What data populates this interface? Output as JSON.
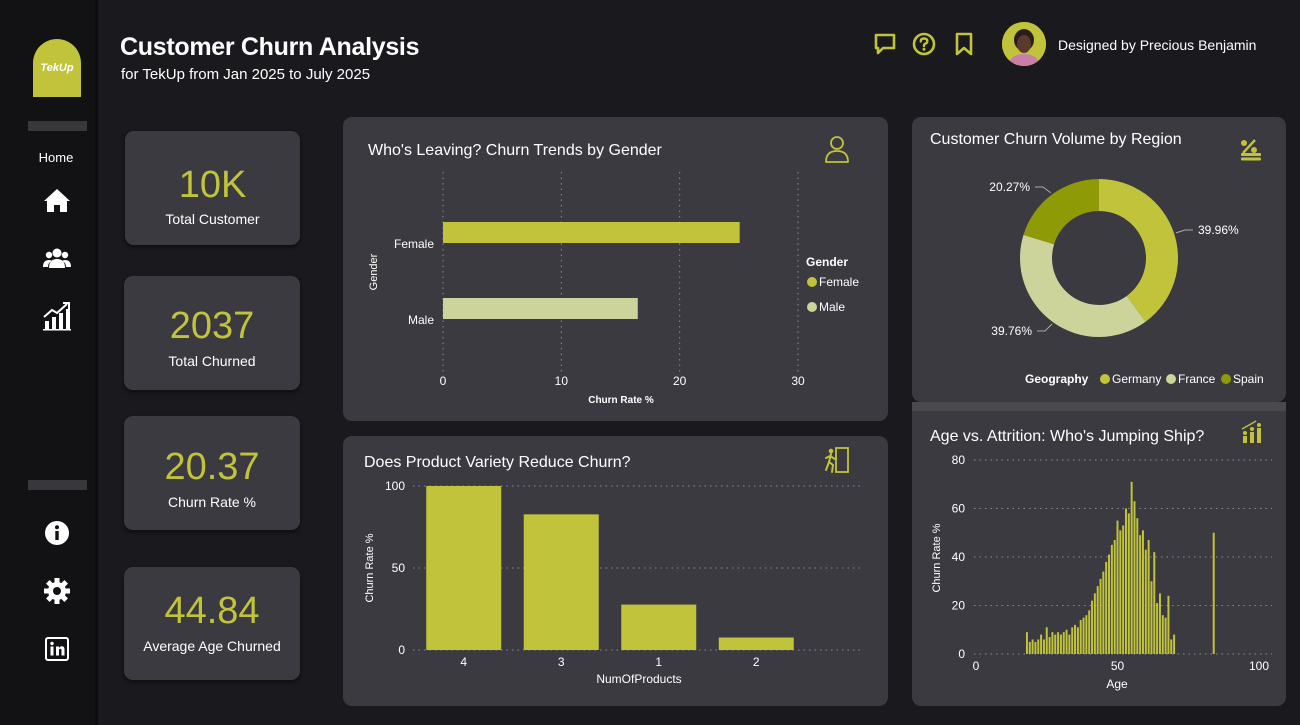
{
  "header": {
    "title": "Customer Churn Analysis",
    "subtitle": "for TekUp from Jan 2025 to July 2025",
    "designer": "Designed by Precious Benjamin"
  },
  "sidebar": {
    "logo": "TekUp",
    "home_label": "Home"
  },
  "kpis": [
    {
      "value": "10K",
      "label": "Total Customer"
    },
    {
      "value": "2037",
      "label": "Total Churned"
    },
    {
      "value": "20.37",
      "label": "Churn Rate %"
    },
    {
      "value": "44.84",
      "label": "Average Age Churned"
    }
  ],
  "colors": {
    "accent": "#c1c43a",
    "light": "#ccd39b",
    "dark": "#8f9a07",
    "panel": "#3b3a40",
    "bg": "#1a191d"
  },
  "chart_data": [
    {
      "type": "bar",
      "orientation": "horizontal",
      "title": "Who's Leaving? Churn Trends by Gender",
      "xlabel": "Churn Rate %",
      "ylabel": "Gender",
      "categories": [
        "Female",
        "Male"
      ],
      "values": [
        25.07,
        16.46
      ],
      "xlim": [
        0,
        30
      ],
      "xticks": [
        "0",
        "10",
        "20",
        "30"
      ],
      "legend": {
        "title": "Gender",
        "items": [
          "Female",
          "Male"
        ],
        "placement": "right"
      }
    },
    {
      "type": "pie",
      "title": "Customer Churn Volume by Region",
      "categories": [
        "Germany",
        "France",
        "Spain"
      ],
      "values": [
        39.96,
        39.76,
        20.27
      ],
      "labels": [
        "39.96%",
        "39.76%",
        "20.27%"
      ],
      "legend": {
        "title": "Geography",
        "items": [
          "Germany",
          "France",
          "Spain"
        ],
        "placement": "bottom-right"
      }
    },
    {
      "type": "bar",
      "title": "Does Product Variety Reduce Churn?",
      "xlabel": "NumOfProducts",
      "ylabel": "Churn Rate %",
      "categories": [
        "4",
        "3",
        "1",
        "2"
      ],
      "values": [
        100,
        82.7,
        27.7,
        7.6
      ],
      "ylim": [
        0,
        100
      ],
      "yticks": [
        "0",
        "50",
        "100"
      ],
      "grid": true
    },
    {
      "type": "bar",
      "title": "Age vs. Attrition: Who's Jumping Ship?",
      "xlabel": "Age",
      "ylabel": "Churn Rate %",
      "xlim": [
        0,
        100
      ],
      "ylim": [
        0,
        80
      ],
      "xticks": [
        "0",
        "50",
        "100"
      ],
      "yticks": [
        "0",
        "20",
        "40",
        "60",
        "80"
      ],
      "x": [
        18,
        19,
        20,
        21,
        22,
        23,
        24,
        25,
        26,
        27,
        28,
        29,
        30,
        31,
        32,
        33,
        34,
        35,
        36,
        37,
        38,
        39,
        40,
        41,
        42,
        43,
        44,
        45,
        46,
        47,
        48,
        49,
        50,
        51,
        52,
        53,
        54,
        55,
        56,
        57,
        58,
        59,
        60,
        61,
        62,
        63,
        64,
        65,
        66,
        67,
        68,
        69,
        70,
        84
      ],
      "values": [
        9,
        5,
        6,
        5,
        6,
        8,
        6,
        11,
        7,
        9,
        8,
        9,
        8,
        9,
        10,
        8,
        11,
        12,
        11,
        14,
        15,
        16,
        18,
        22,
        25,
        28,
        31,
        34,
        38,
        41,
        45,
        47,
        55,
        51,
        53,
        60,
        58,
        71,
        63,
        56,
        49,
        51,
        43,
        47,
        30,
        42,
        21,
        25,
        16,
        15,
        24,
        6,
        8,
        50
      ],
      "grid": true
    }
  ]
}
